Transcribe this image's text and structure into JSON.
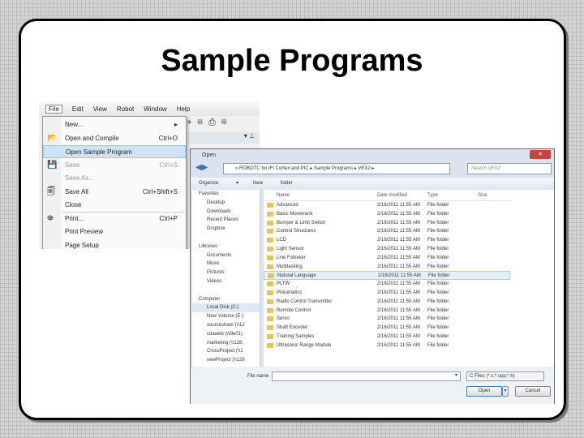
{
  "slide": {
    "title": "Sample Programs"
  },
  "menubar": [
    "File",
    "Edit",
    "View",
    "Robot",
    "Window",
    "Help"
  ],
  "toolbar_icons": "⌖⛯⎙⛯",
  "file_menu": [
    {
      "label": "New...",
      "shortcut": "▸",
      "icon": ""
    },
    {
      "label": "Open and Compile",
      "shortcut": "Ctrl+O",
      "icon": "📂"
    },
    {
      "label": "Open Sample Program",
      "shortcut": "",
      "icon": ""
    },
    {
      "label": "Save",
      "shortcut": "Ctrl+S",
      "icon": "💾"
    },
    {
      "label": "Save As...",
      "shortcut": "",
      "icon": ""
    },
    {
      "label": "Save All",
      "shortcut": "Ctrl+Shift+S",
      "icon": "🗐"
    },
    {
      "label": "Close",
      "shortcut": "",
      "icon": ""
    },
    {
      "label": "Print...",
      "shortcut": "Ctrl+P",
      "icon": "⛯"
    },
    {
      "label": "Print Preview",
      "shortcut": "",
      "icon": ""
    },
    {
      "label": "Page Setup",
      "shortcut": "",
      "icon": ""
    }
  ],
  "dialog": {
    "title": "Open",
    "close": "✕",
    "address": "« ROBOTC for IFI Cortex and PIC ▸ Sample Programs ▸ VEX2 ▸",
    "search_placeholder": "Search VEX2",
    "organize": "Organize ▾",
    "new_folder": "New folder",
    "nav": [
      {
        "label": "Favorites",
        "h": true
      },
      {
        "label": "Desktop"
      },
      {
        "label": "Downloads"
      },
      {
        "label": "Recent Places"
      },
      {
        "label": "Dropbox"
      },
      {
        "label": ""
      },
      {
        "label": "Libraries",
        "h": true
      },
      {
        "label": "Documents"
      },
      {
        "label": "Music"
      },
      {
        "label": "Pictures"
      },
      {
        "label": "Videos"
      },
      {
        "label": ""
      },
      {
        "label": "Computer",
        "h": true
      },
      {
        "label": "Local Disk (C:)",
        "sel": true
      },
      {
        "label": "New Volume (E:)"
      },
      {
        "label": "sourceshare (\\\\12"
      },
      {
        "label": "cdaweb (\\\\file01)"
      },
      {
        "label": "marketing (\\\\128."
      },
      {
        "label": "CrossProject (\\\\1"
      },
      {
        "label": "newProject (\\\\128"
      }
    ],
    "columns": [
      "Name",
      "Date modified",
      "Type",
      "Size"
    ],
    "files": [
      "Advanced",
      "Basic Movement",
      "Bumper & Limit Switch",
      "Control Structures",
      "LCD",
      "Light Sensor",
      "Line Follower",
      "Multitasking",
      "Natural Language",
      "PLTW",
      "Pneumatics",
      "Radio Control Transmitter",
      "Remote Control",
      "Servo",
      "Shaft Encoder",
      "Training Samples",
      "Ultrasonic Range Module"
    ],
    "date": "2/16/2011 11:55 AM",
    "type": "File folder",
    "selected_index": 8,
    "file_name_label": "File name",
    "file_name_value": "",
    "file_type": "C Files (*.c;*.cpp;*.h)",
    "open": "Open",
    "cancel": "Cancel"
  }
}
